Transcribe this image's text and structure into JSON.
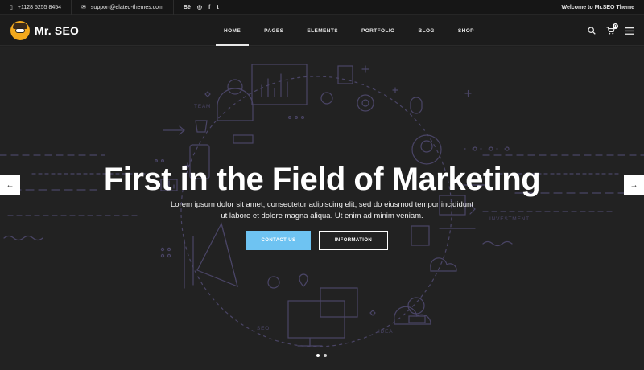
{
  "topbar": {
    "phone": "+1128 5255 8454",
    "email": "support@elated-themes.com",
    "social": [
      "Bē",
      "◎",
      "f",
      "t"
    ],
    "welcome": "Welcome to Mr.SEO Theme"
  },
  "header": {
    "logo_text": "Mr. SEO",
    "nav": [
      "HOME",
      "PAGES",
      "ELEMENTS",
      "PORTFOLIO",
      "BLOG",
      "SHOP"
    ],
    "active_nav": "HOME",
    "cart_count": "0"
  },
  "hero": {
    "title": "First in the Field of Marketing",
    "subtitle_line1": "Lorem ipsum dolor sit amet, consectetur adipiscing elit, sed do eiusmod tempor incididunt",
    "subtitle_line2": "ut labore et dolore magna aliqua. Ut enim ad minim veniam.",
    "contact_label": "CONTACT US",
    "info_label": "INFORMATION",
    "labels": {
      "team": "TEAM",
      "investment": "INVESTMENT",
      "seo": "SEO",
      "idea": "IDEA"
    },
    "slide_count": 2,
    "active_slide": 1
  },
  "colors": {
    "accent": "#6ec3f2",
    "line_art": "#4a4566",
    "background": "#222222"
  }
}
